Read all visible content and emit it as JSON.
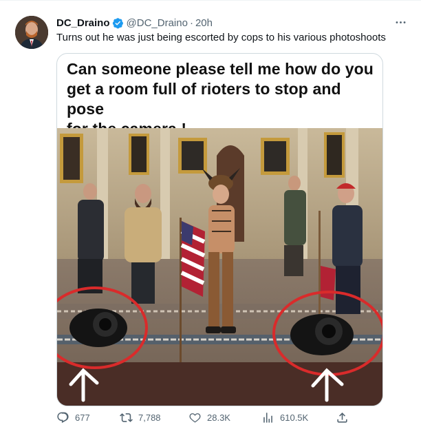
{
  "author": {
    "display_name": "DC_Draino",
    "handle": "@DC_Draino",
    "separator": "·",
    "time": "20h",
    "verified": true
  },
  "tweet": {
    "text": "Turns out he was just being escorted by cops to his various photoshoots"
  },
  "media": {
    "caption_lines": [
      "Can someone please tell me how do you",
      "get a room full of rioters to stop and pose",
      "for the camera !"
    ]
  },
  "metrics": {
    "replies": "677",
    "retweets": "7,788",
    "likes": "28.3K",
    "views": "610.5K"
  },
  "icons": {
    "more": "more-icon",
    "verified": "verified-badge-icon",
    "reply": "reply-icon",
    "retweet": "retweet-icon",
    "like": "heart-icon",
    "views": "analytics-icon",
    "share": "share-icon"
  },
  "colors": {
    "text_primary": "#0f1419",
    "text_secondary": "#536471",
    "verified_blue": "#1d9bf0",
    "annotation_red": "#d92b2b"
  }
}
